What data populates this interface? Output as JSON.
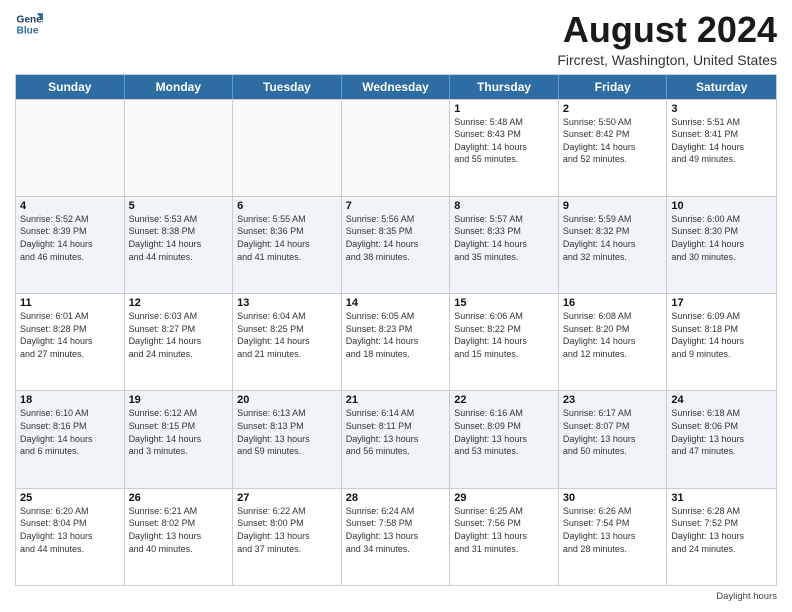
{
  "header": {
    "logo_line1": "General",
    "logo_line2": "Blue",
    "month_title": "August 2024",
    "location": "Fircrest, Washington, United States"
  },
  "days_of_week": [
    "Sunday",
    "Monday",
    "Tuesday",
    "Wednesday",
    "Thursday",
    "Friday",
    "Saturday"
  ],
  "weeks": [
    [
      {
        "day": "",
        "info": ""
      },
      {
        "day": "",
        "info": ""
      },
      {
        "day": "",
        "info": ""
      },
      {
        "day": "",
        "info": ""
      },
      {
        "day": "1",
        "info": "Sunrise: 5:48 AM\nSunset: 8:43 PM\nDaylight: 14 hours\nand 55 minutes."
      },
      {
        "day": "2",
        "info": "Sunrise: 5:50 AM\nSunset: 8:42 PM\nDaylight: 14 hours\nand 52 minutes."
      },
      {
        "day": "3",
        "info": "Sunrise: 5:51 AM\nSunset: 8:41 PM\nDaylight: 14 hours\nand 49 minutes."
      }
    ],
    [
      {
        "day": "4",
        "info": "Sunrise: 5:52 AM\nSunset: 8:39 PM\nDaylight: 14 hours\nand 46 minutes."
      },
      {
        "day": "5",
        "info": "Sunrise: 5:53 AM\nSunset: 8:38 PM\nDaylight: 14 hours\nand 44 minutes."
      },
      {
        "day": "6",
        "info": "Sunrise: 5:55 AM\nSunset: 8:36 PM\nDaylight: 14 hours\nand 41 minutes."
      },
      {
        "day": "7",
        "info": "Sunrise: 5:56 AM\nSunset: 8:35 PM\nDaylight: 14 hours\nand 38 minutes."
      },
      {
        "day": "8",
        "info": "Sunrise: 5:57 AM\nSunset: 8:33 PM\nDaylight: 14 hours\nand 35 minutes."
      },
      {
        "day": "9",
        "info": "Sunrise: 5:59 AM\nSunset: 8:32 PM\nDaylight: 14 hours\nand 32 minutes."
      },
      {
        "day": "10",
        "info": "Sunrise: 6:00 AM\nSunset: 8:30 PM\nDaylight: 14 hours\nand 30 minutes."
      }
    ],
    [
      {
        "day": "11",
        "info": "Sunrise: 6:01 AM\nSunset: 8:28 PM\nDaylight: 14 hours\nand 27 minutes."
      },
      {
        "day": "12",
        "info": "Sunrise: 6:03 AM\nSunset: 8:27 PM\nDaylight: 14 hours\nand 24 minutes."
      },
      {
        "day": "13",
        "info": "Sunrise: 6:04 AM\nSunset: 8:25 PM\nDaylight: 14 hours\nand 21 minutes."
      },
      {
        "day": "14",
        "info": "Sunrise: 6:05 AM\nSunset: 8:23 PM\nDaylight: 14 hours\nand 18 minutes."
      },
      {
        "day": "15",
        "info": "Sunrise: 6:06 AM\nSunset: 8:22 PM\nDaylight: 14 hours\nand 15 minutes."
      },
      {
        "day": "16",
        "info": "Sunrise: 6:08 AM\nSunset: 8:20 PM\nDaylight: 14 hours\nand 12 minutes."
      },
      {
        "day": "17",
        "info": "Sunrise: 6:09 AM\nSunset: 8:18 PM\nDaylight: 14 hours\nand 9 minutes."
      }
    ],
    [
      {
        "day": "18",
        "info": "Sunrise: 6:10 AM\nSunset: 8:16 PM\nDaylight: 14 hours\nand 6 minutes."
      },
      {
        "day": "19",
        "info": "Sunrise: 6:12 AM\nSunset: 8:15 PM\nDaylight: 14 hours\nand 3 minutes."
      },
      {
        "day": "20",
        "info": "Sunrise: 6:13 AM\nSunset: 8:13 PM\nDaylight: 13 hours\nand 59 minutes."
      },
      {
        "day": "21",
        "info": "Sunrise: 6:14 AM\nSunset: 8:11 PM\nDaylight: 13 hours\nand 56 minutes."
      },
      {
        "day": "22",
        "info": "Sunrise: 6:16 AM\nSunset: 8:09 PM\nDaylight: 13 hours\nand 53 minutes."
      },
      {
        "day": "23",
        "info": "Sunrise: 6:17 AM\nSunset: 8:07 PM\nDaylight: 13 hours\nand 50 minutes."
      },
      {
        "day": "24",
        "info": "Sunrise: 6:18 AM\nSunset: 8:06 PM\nDaylight: 13 hours\nand 47 minutes."
      }
    ],
    [
      {
        "day": "25",
        "info": "Sunrise: 6:20 AM\nSunset: 8:04 PM\nDaylight: 13 hours\nand 44 minutes."
      },
      {
        "day": "26",
        "info": "Sunrise: 6:21 AM\nSunset: 8:02 PM\nDaylight: 13 hours\nand 40 minutes."
      },
      {
        "day": "27",
        "info": "Sunrise: 6:22 AM\nSunset: 8:00 PM\nDaylight: 13 hours\nand 37 minutes."
      },
      {
        "day": "28",
        "info": "Sunrise: 6:24 AM\nSunset: 7:58 PM\nDaylight: 13 hours\nand 34 minutes."
      },
      {
        "day": "29",
        "info": "Sunrise: 6:25 AM\nSunset: 7:56 PM\nDaylight: 13 hours\nand 31 minutes."
      },
      {
        "day": "30",
        "info": "Sunrise: 6:26 AM\nSunset: 7:54 PM\nDaylight: 13 hours\nand 28 minutes."
      },
      {
        "day": "31",
        "info": "Sunrise: 6:28 AM\nSunset: 7:52 PM\nDaylight: 13 hours\nand 24 minutes."
      }
    ]
  ],
  "footer": {
    "note": "Daylight hours"
  }
}
